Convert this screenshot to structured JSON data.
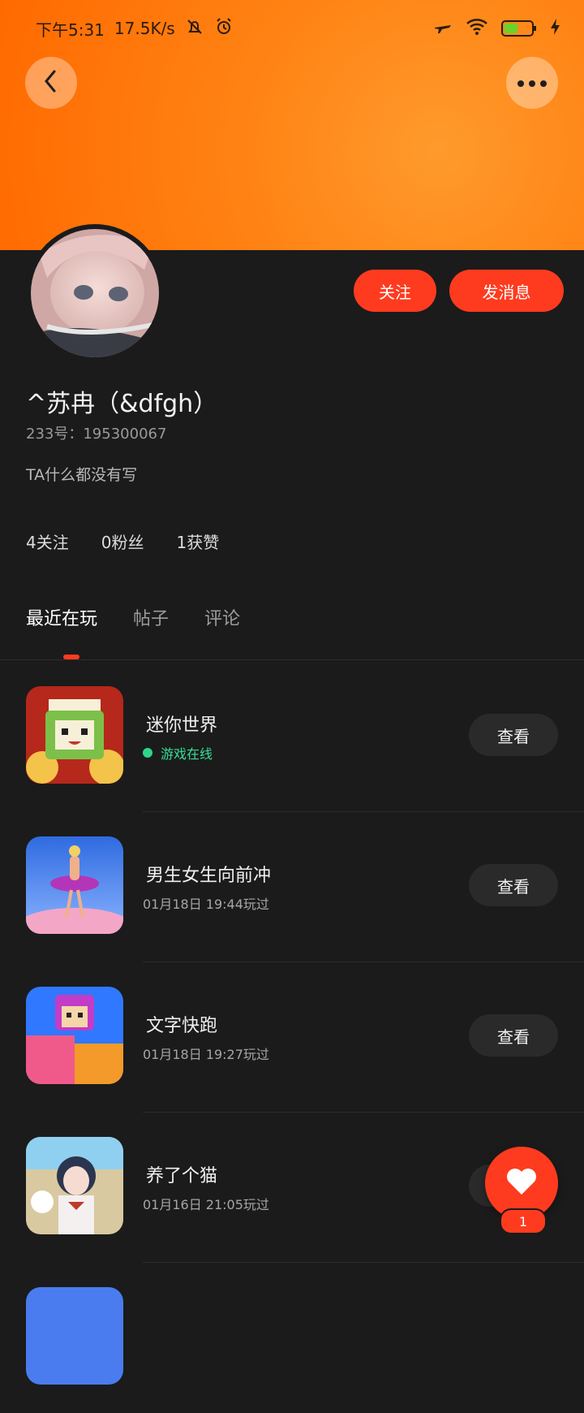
{
  "status_bar": {
    "time": "下午5:31",
    "speed": "17.5K/s",
    "battery": "41"
  },
  "profile": {
    "name": "^苏冉（&dfgh）",
    "id_line": "233号：195300067",
    "bio": "TA什么都没有写",
    "stats": [
      "4关注",
      "0粉丝",
      "1获赞"
    ]
  },
  "actions": {
    "follow": "关注",
    "message": "发消息"
  },
  "tabs": [
    "最近在玩",
    "帖子",
    "评论"
  ],
  "games": [
    {
      "title": "迷你世界",
      "status": "游戏在线",
      "btn": "查看"
    },
    {
      "title": "男生女生向前冲",
      "time": "01月18日 19:44玩过",
      "btn": "查看"
    },
    {
      "title": "文字快跑",
      "time": "01月18日 19:27玩过",
      "btn": "查看"
    },
    {
      "title": "养了个猫",
      "time": "01月16日 21:05玩过",
      "btn": "查看"
    }
  ],
  "fab": {
    "count": "1"
  },
  "colors": {
    "accent": "#ff3b1f",
    "banner": "#ff7a00",
    "online": "#35e097",
    "bg": "#1b1b1b"
  },
  "icons": [
    "back-arrow-icon",
    "more-icon",
    "airplane-icon",
    "wifi-icon",
    "battery-icon",
    "charging-icon",
    "mute-icon",
    "alarm-icon",
    "heart-icon"
  ]
}
